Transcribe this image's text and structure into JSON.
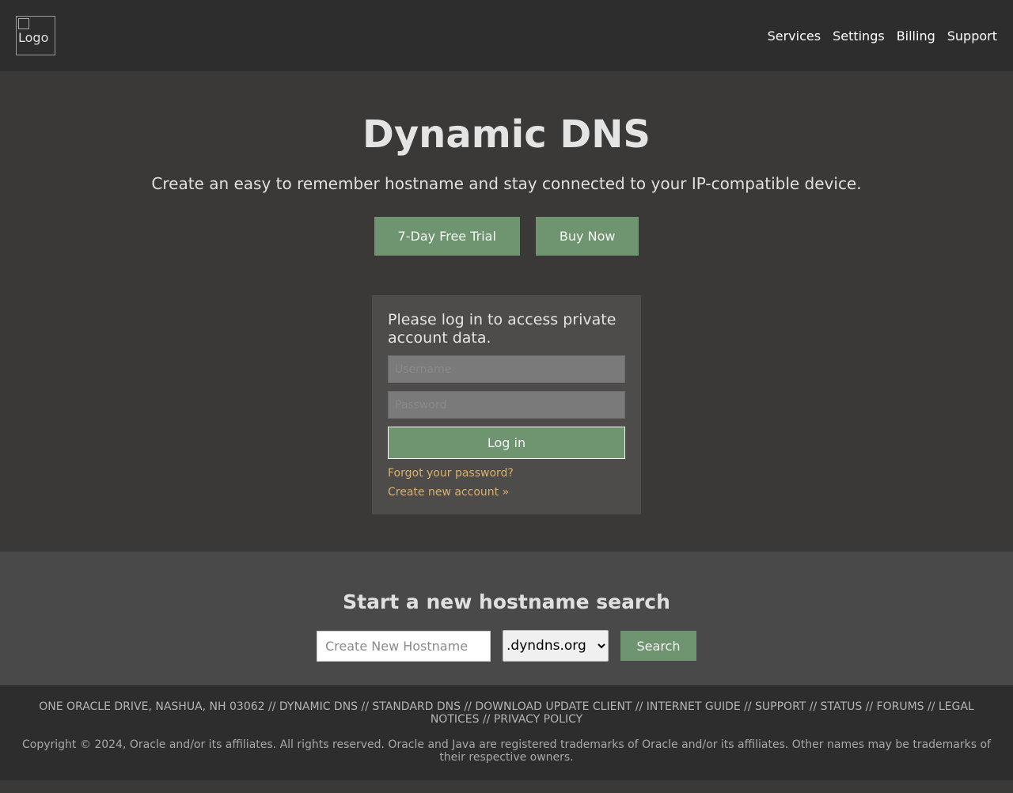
{
  "header": {
    "logo_alt": "Logo",
    "nav": [
      "Services",
      "Settings",
      "Billing",
      "Support"
    ]
  },
  "hero": {
    "title": "Dynamic DNS",
    "subtitle": "Create an easy to remember hostname and stay connected to your IP-compatible device.",
    "trial_label": "7-Day Free Trial",
    "buy_label": "Buy Now"
  },
  "login": {
    "prompt": "Please log in to access private account data.",
    "username_placeholder": "Username",
    "password_placeholder": "Password",
    "login_label": "Log in",
    "forgot_label": "Forgot your password?",
    "create_label": "Create new account »"
  },
  "search": {
    "title": "Start a new hostname search",
    "placeholder": "Create New Hostname",
    "domain_selected": ".dyndns.org",
    "button_label": "Search"
  },
  "footer": {
    "links": "ONE ORACLE DRIVE, NASHUA, NH 03062 // DYNAMIC DNS // STANDARD DNS // DOWNLOAD UPDATE CLIENT // INTERNET GUIDE // SUPPORT // STATUS // FORUMS // LEGAL NOTICES // PRIVACY POLICY",
    "copyright": "Copyright © 2024, Oracle and/or its affiliates. All rights reserved. Oracle and Java are registered trademarks of Oracle and/or its affiliates. Other names may be trademarks of their respective owners."
  },
  "colors": {
    "accent_green": "#6f9570",
    "link_gold": "#d9b06c",
    "header_bg": "#2d2d2d",
    "page_bg": "#3a3937"
  }
}
